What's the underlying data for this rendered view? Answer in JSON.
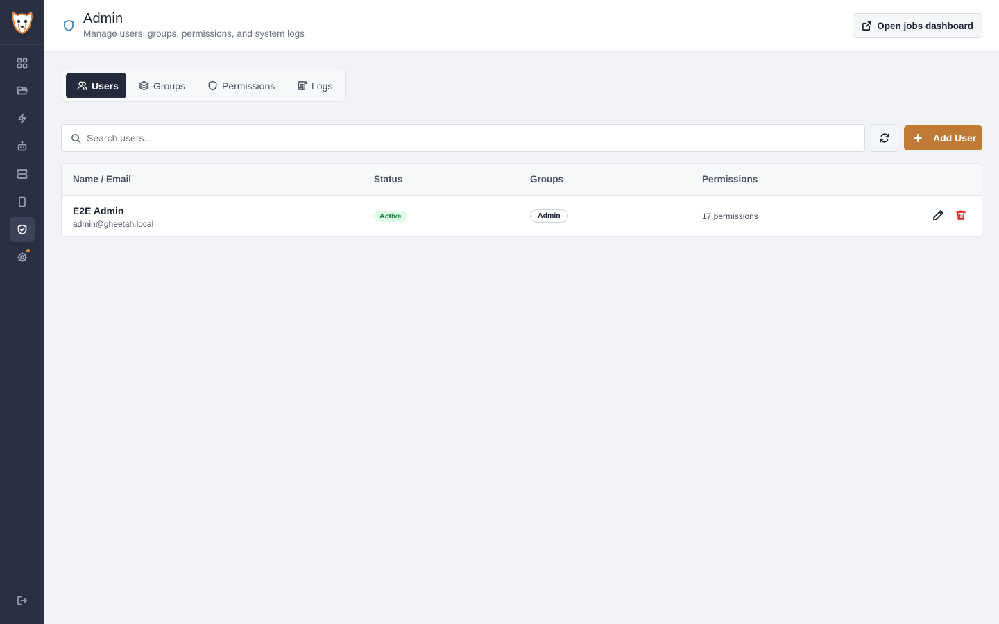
{
  "sidebar": {
    "logo": "cheetah-logo",
    "items": [
      {
        "name": "dashboard-icon",
        "active": false
      },
      {
        "name": "folder-icon",
        "active": false
      },
      {
        "name": "lightning-icon",
        "active": false
      },
      {
        "name": "robot-icon",
        "active": false
      },
      {
        "name": "server-icon",
        "active": false
      },
      {
        "name": "phone-icon",
        "active": false
      },
      {
        "name": "shield-check-icon",
        "active": true
      },
      {
        "name": "gear-icon",
        "active": false,
        "notification": true
      }
    ],
    "logout": "logout-icon"
  },
  "header": {
    "title": "Admin",
    "subtitle": "Manage users, groups, permissions, and system logs",
    "jobs_button": "Open jobs dashboard"
  },
  "tabs": [
    {
      "label": "Users",
      "active": true
    },
    {
      "label": "Groups",
      "active": false
    },
    {
      "label": "Permissions",
      "active": false
    },
    {
      "label": "Logs",
      "active": false
    }
  ],
  "search": {
    "placeholder": "Search users..."
  },
  "add_button": "Add User",
  "table": {
    "columns": [
      "Name / Email",
      "Status",
      "Groups",
      "Permissions"
    ],
    "rows": [
      {
        "name": "E2E Admin",
        "email": "admin@gheetah.local",
        "status": "Active",
        "group": "Admin",
        "permissions": "17 permissions"
      }
    ]
  },
  "colors": {
    "sidebar": "#2b2f42",
    "accent": "#c17a36",
    "active_tab": "#252a3d",
    "status_active": "#15803d",
    "danger": "#dc2626"
  }
}
